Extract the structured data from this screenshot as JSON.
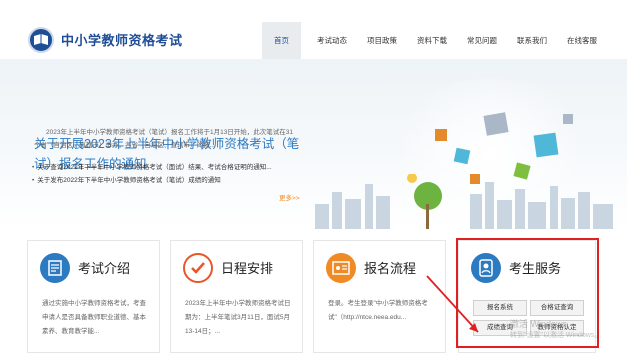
{
  "header": {
    "site_title": "中小学教师资格考试",
    "nav": [
      "首页",
      "考试动态",
      "项目政策",
      "资料下载",
      "常见问题",
      "联系我们",
      "在线客服"
    ]
  },
  "banner": {
    "headline": "关于开展2023年上半年中小学教师资格考试（笔试）报名工作的通知",
    "intro": "2023年上半年中小学教师资格考试（笔试）报名工作将于1月13日开始，此次笔试在31个省（自治区、直辖市）举办，各省（自治区、直辖市）的报...",
    "news": [
      "关于查询2022年下半年中小学教师资格考试（面试）结果、考试合格证明的通知...",
      "关于发布2022年下半年中小学教师资格考试（笔试）成绩的通知"
    ],
    "more": "更多>>"
  },
  "cards": [
    {
      "title": "考试介绍",
      "text": "通过实施中小学教师资格考试，考查申请人是否具备教师职业道德、基本素养、教育教学能..."
    },
    {
      "title": "日程安排",
      "text": "2023年上半年中小学教师资格考试日期为：上半年笔试3月11日，面试5月13-14日；..."
    },
    {
      "title": "报名流程",
      "text": "登录。考生登录\"中小学教师资格考试\"（http://ntce.neea.edu..."
    },
    {
      "title": "考生服务"
    }
  ],
  "services": [
    "报名系统",
    "合格证查询",
    "成绩查询",
    "教师资格认定"
  ],
  "watermark": [
    "激活 Windows",
    "转到\"设置\"以激活 Windows。"
  ],
  "colors": {
    "brand": "#1f4e96",
    "accent": "#f08a24",
    "headline": "#2c7ac2",
    "highlight": "#e02020"
  }
}
